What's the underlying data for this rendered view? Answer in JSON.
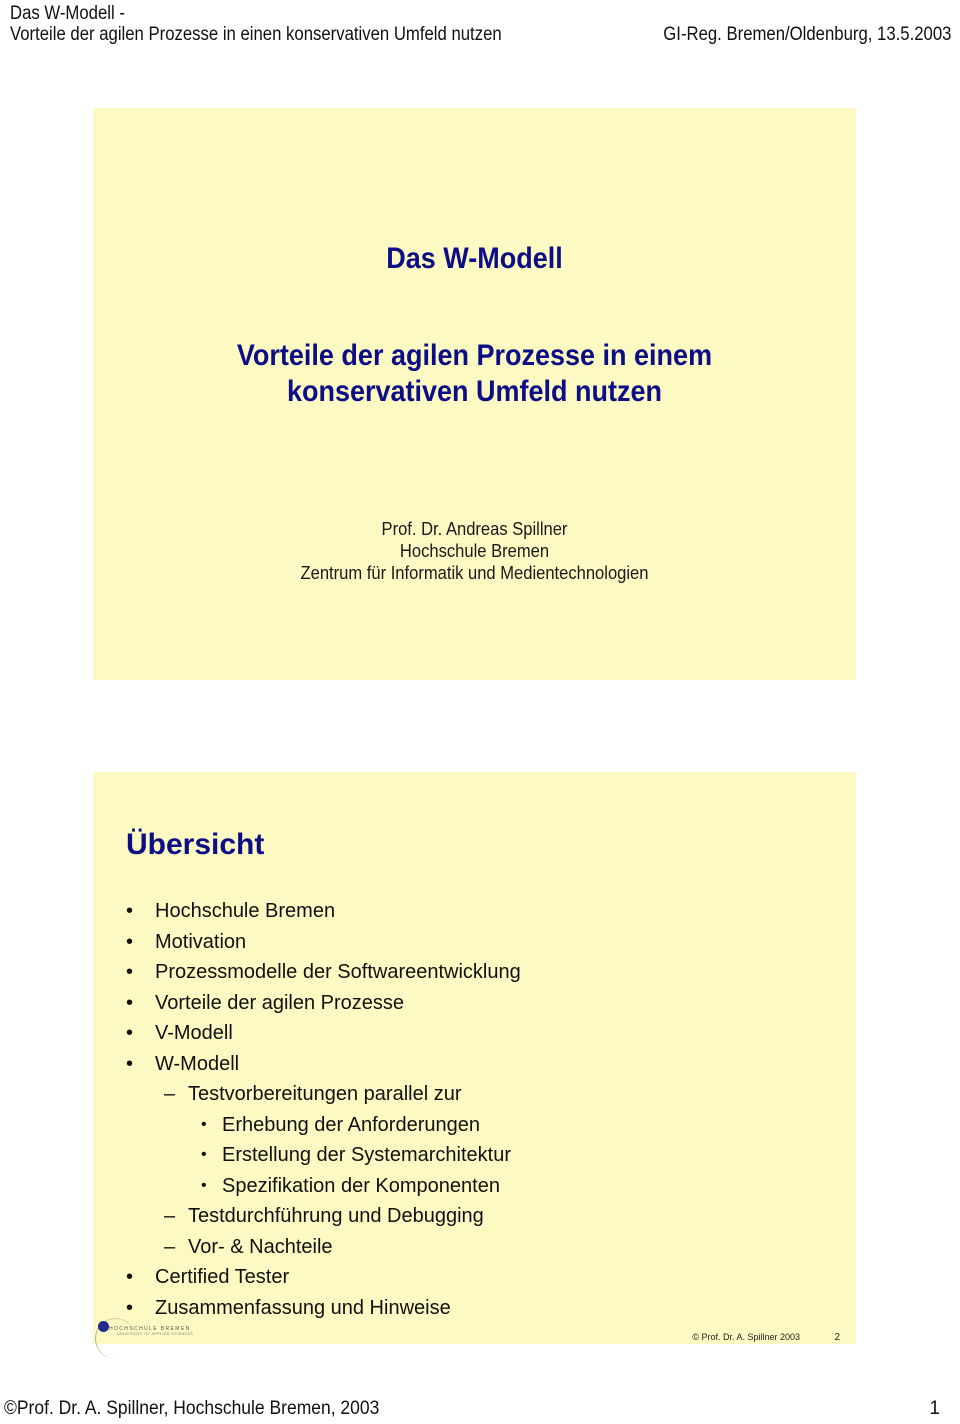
{
  "header": {
    "line1": "Das W-Modell -",
    "line2": "Vorteile der agilen Prozesse in einen konservativen Umfeld nutzen",
    "event": "GI-Reg. Bremen/Oldenburg, 13.5.2003"
  },
  "colors": {
    "slide_background": "#fcf9c3",
    "title_color": "#0d0d85",
    "logo_dot": "#1f2a8c"
  },
  "slide1": {
    "title": "Das W-Modell",
    "subtitle_line1": "Vorteile der agilen Prozesse in einem",
    "subtitle_line2": "konservativen Umfeld nutzen",
    "author": "Prof. Dr. Andreas Spillner",
    "institution": "Hochschule Bremen",
    "department": "Zentrum für Informatik und Medientechnologien"
  },
  "slide2": {
    "title": "Übersicht",
    "items": [
      {
        "level": 1,
        "marker": "•",
        "text": "Hochschule Bremen"
      },
      {
        "level": 1,
        "marker": "•",
        "text": "Motivation"
      },
      {
        "level": 1,
        "marker": "•",
        "text": "Prozessmodelle der Softwareentwicklung"
      },
      {
        "level": 1,
        "marker": "•",
        "text": "Vorteile der agilen Prozesse"
      },
      {
        "level": 1,
        "marker": "•",
        "text": "V-Modell"
      },
      {
        "level": 1,
        "marker": "•",
        "text": "W-Modell"
      },
      {
        "level": 2,
        "marker": "–",
        "text": "Testvorbereitungen parallel zur"
      },
      {
        "level": 3,
        "marker": "•",
        "text": "Erhebung der Anforderungen"
      },
      {
        "level": 3,
        "marker": "•",
        "text": "Erstellung der Systemarchitektur"
      },
      {
        "level": 3,
        "marker": "•",
        "text": "Spezifikation der Komponenten"
      },
      {
        "level": 2,
        "marker": "–",
        "text": "Testdurchführung und Debugging"
      },
      {
        "level": 2,
        "marker": "–",
        "text": "Vor- & Nachteile"
      },
      {
        "level": 1,
        "marker": "•",
        "text": "Certified Tester"
      },
      {
        "level": 1,
        "marker": "•",
        "text": "Zusammenfassung und Hinweise"
      }
    ],
    "logo": {
      "icon": "hochschule-bremen-logo-icon",
      "name": "HOCHSCHULE BREMEN",
      "subtitle": "UNIVERSITY OF APPLIED SCIENCES"
    },
    "copyright": "© Prof. Dr. A. Spillner 2003",
    "slide_number": "2"
  },
  "footer": {
    "copyright": "©Prof. Dr. A. Spillner, Hochschule Bremen, 2003",
    "page_number": "1"
  }
}
